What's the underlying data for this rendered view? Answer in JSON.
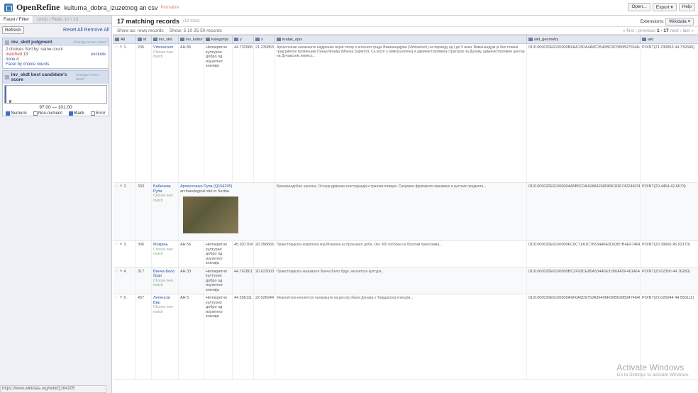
{
  "header": {
    "app_name": "OpenRefine",
    "project_name": "kulturna_dobra_izuzetnog an csv",
    "permalink": "Permalink",
    "buttons": [
      "Open...",
      "Export ▾",
      "Help"
    ]
  },
  "left_panel": {
    "tabs": [
      "Facet / Filter",
      "Undo / Redo 10 / 13"
    ],
    "refresh": "Refresh",
    "reset_all": "Reset All",
    "remove_all": "Remove All",
    "facet1": {
      "title": "inv_skdt judgment",
      "options": "change invert reset",
      "choices": "2 choices Sort by: name count",
      "item1": "matched",
      "item1_count": "13",
      "item1_action": "exclude",
      "item2": "none",
      "item2_count": "4",
      "cluster": "Facet by choice counts"
    },
    "facet2": {
      "title": "inv_skdt best candidate's score",
      "options": "change invert reset",
      "range": "97.00 — 101.00",
      "checks": [
        {
          "label": "Numeric",
          "on": true
        },
        {
          "label": "Non-numeric",
          "on": false
        },
        {
          "label": "Blank",
          "on": true
        },
        {
          "label": "Error",
          "on": false
        }
      ]
    }
  },
  "summary": {
    "count": "17 matching records",
    "total": "(19 total)",
    "extensions_label": "Extensions:",
    "extensions_value": "Wikidata ▾"
  },
  "view": {
    "show_as": "Show as: rows records",
    "show": "Show: 5 10 25 50 records",
    "pager": "« first ‹ previous",
    "range": "1 - 17",
    "pager_next": "next › last »"
  },
  "columns": [
    "All",
    "id",
    "inv_skd",
    "inv_kultur",
    "kategorija",
    "y",
    "x",
    "kratak_opis",
    "wkt_geometry",
    "wkt"
  ],
  "rows": [
    {
      "n": "1.",
      "id": "236",
      "name": "Viminacium",
      "note": "Choose new match",
      "inv": "АН 86",
      "cat": "Непокретно културно добро од изузетног значаја",
      "y": "44.732686",
      "x": "21.230853",
      "desc": "Археолошки налазиште најдрешко војни логор и античког града Виминацијума (Viminacium) на периоду од I до V века. Виминацијум је био главни град римске провинције Горња Мезија (Moesia Superior). Са косог у римској военој и административној структури на Дунаву, административни центар на Дунавском лимесу...",
      "geom": "0101000020E6100000BFAA13DA4A8C3540BD3C5B0B27654640",
      "wkt": "POINT(21.230853 44.732686)"
    },
    {
      "n": "2.",
      "id": "333",
      "name": "Бабичева Рупа",
      "note": "Choose new match",
      "inv": "",
      "cat": "",
      "y": "",
      "x": "",
      "desc": "Бронзанодобно насеље. Остаци дрвених конструкција и трагови пожара. Сачувани фрагменти керамике и култних предмета...",
      "geom": "0101000020E61000004A5B5C0A42A84240D89C83674224603F",
      "wkt": "POINT(20.4454 42.6673)",
      "candidate": "Археолошко Рупа (Q164205)",
      "cand_desc": "archaeological site in Serbia"
    },
    {
      "n": "3.",
      "id": "306",
      "name": "Мокрињ",
      "note": "Choose new match",
      "inv": "АН 56",
      "cat": "Непокретно културно добро од изузетног значаја",
      "y": "45.9317041",
      "x": "20.396656",
      "desc": "Праисторијска некропола код Мокрина из бронзаног доба. Око 300 гробова са богатим прилозима...",
      "geom": "0101000020E6100000FC6C71A1C7653440A3D63B7B4EF74640",
      "wkt": "POINT(20.39666 45.93170)"
    },
    {
      "n": "4.",
      "id": "317",
      "name": "Винча-Бело брдо",
      "note": "Choose new match",
      "inv": "АН 33",
      "cat": "Непокретно културно добро од изузетног значаја",
      "y": "44.762801",
      "x": "20.623003",
      "desc": "Праисторијско налазиште Винча Бело брдо, неолитска култура...",
      "geom": "0101000020E6100000BC2F93CE80A53440E31B0AF5F4614640",
      "wkt": "POINT(20.62300 44.76280)"
    },
    {
      "n": "5.",
      "id": "457",
      "name": "Лепенски Вир",
      "note": "Choose new match",
      "inv": "АН 5",
      "cat": "Непокретно културно добро од изузетног значаја",
      "y": "44.556111",
      "x": "22.026944",
      "desc": "Мезолитско-неолитско налазиште на десној обали Дунава у Ђердапској клисури...",
      "geom": "0101000020E6100000A6F0A0D9750A36406FD8B628B3474640",
      "wkt": "POINT(22.026944 44.556111)"
    }
  ],
  "status_url": "https://www.wikidata.org/wiki/Q164205",
  "watermark": {
    "title": "Activate Windows",
    "sub": "Go to Settings to activate Windows."
  }
}
